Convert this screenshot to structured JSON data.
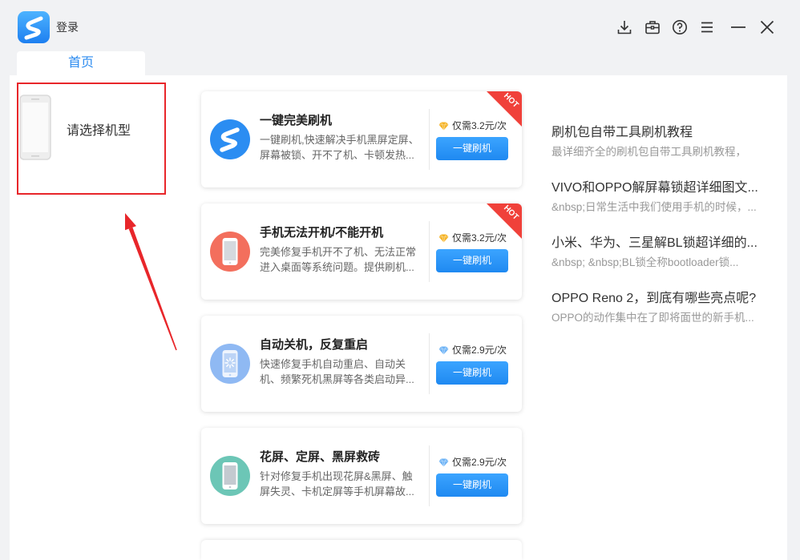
{
  "window": {
    "login_label": "登录",
    "logo_icon": "app-logo-icon",
    "toolbar_icons": [
      "download-icon",
      "toolbox-icon",
      "help-icon",
      "menu-icon",
      "minimize-icon",
      "close-icon"
    ]
  },
  "tabs": [
    {
      "label": "首页",
      "active": true
    }
  ],
  "device_selector": {
    "label": "请选择机型",
    "icon": "phone-placeholder-icon"
  },
  "services": [
    {
      "title": "一键完美刷机",
      "desc_lines": [
        "一键刷机,快速解决手机黑屏定屏、",
        "屏幕被锁、开不了机、卡顿发热..."
      ],
      "price": "仅需3.2元/次",
      "price_icon": "diamond-icon",
      "price_icon_color": "#f5b325",
      "button_label": "一键刷机",
      "badge": "HOT",
      "icon": "flash-logo-icon",
      "icon_color": "#2b8df2"
    },
    {
      "title": "手机无法开机/不能开机",
      "desc_lines": [
        "完美修复手机开不了机、无法正常",
        "进入桌面等系统问题。提供刷机..."
      ],
      "price": "仅需3.2元/次",
      "price_icon": "diamond-icon",
      "price_icon_color": "#f5b325",
      "button_label": "一键刷机",
      "badge": "HOT",
      "icon": "phone-icon",
      "icon_color": "#f36f5d"
    },
    {
      "title": "自动关机，反复重启",
      "desc_lines": [
        "快速修复手机自动重启、自动关",
        "机、频繁死机黑屏等各类启动异..."
      ],
      "price": "仅需2.9元/次",
      "price_icon": "diamond-icon",
      "price_icon_color": "#6db3f6",
      "button_label": "一键刷机",
      "icon": "phone-restart-icon",
      "icon_color": "#8fb9f3"
    },
    {
      "title": "花屏、定屏、黑屏救砖",
      "desc_lines": [
        "针对修复手机出现花屏&黑屏、触",
        "屏失灵、卡机定屏等手机屏幕故..."
      ],
      "price": "仅需2.9元/次",
      "price_icon": "diamond-icon",
      "price_icon_color": "#6db3f6",
      "button_label": "一键刷机",
      "icon": "phone-screen-icon",
      "icon_color": "#6cc6b6"
    }
  ],
  "articles": [
    {
      "title": "刷机包自带工具刷机教程",
      "summary": "最详细齐全的刷机包自带工具刷机教程，"
    },
    {
      "title": "VIVO和OPPO解屏幕锁超详细图文...",
      "summary": "&nbsp;日常生活中我们使用手机的时候，..."
    },
    {
      "title": "小米、华为、三星解BL锁超详细的...",
      "summary": "&nbsp; &nbsp;BL锁全称bootloader锁..."
    },
    {
      "title": "OPPO Reno 2，到底有哪些亮点呢?",
      "summary": "OPPO的动作集中在了即将面世的新手机..."
    }
  ],
  "theme": {
    "accent": "#2d8cf0",
    "button": "#2892f3",
    "hot_badge": "#f0413a",
    "annotation": "#e8262a"
  }
}
